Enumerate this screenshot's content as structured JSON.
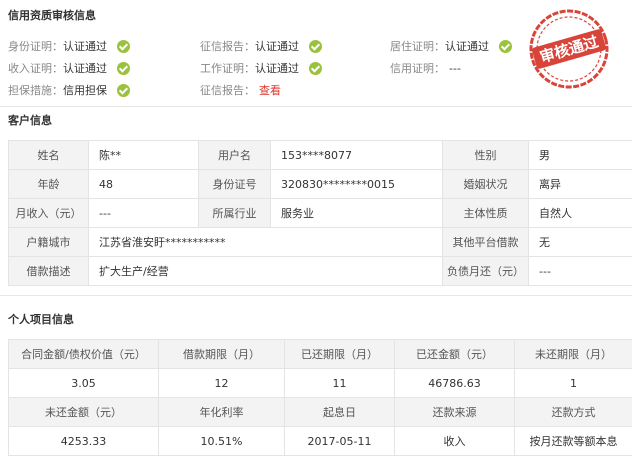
{
  "credit": {
    "title": "信用资质审核信息",
    "items": [
      {
        "label": "身份证明：",
        "value": "认证通过",
        "checked": true
      },
      {
        "label": "征信报告：",
        "value": "认证通过",
        "checked": true
      },
      {
        "label": "居住证明：",
        "value": "认证通过",
        "checked": true
      },
      {
        "label": "收入证明：",
        "value": "认证通过",
        "checked": true
      },
      {
        "label": "工作证明：",
        "value": "认证通过",
        "checked": true
      },
      {
        "label": "信用证明：",
        "value": "---",
        "checked": false
      },
      {
        "label": "担保措施：",
        "value": "信用担保",
        "checked": true
      },
      {
        "label": "征信报告：",
        "value": "查看",
        "checked": false,
        "link": true
      }
    ],
    "stamp_text": "审核通过",
    "stamp_color": "#d9443a"
  },
  "customer": {
    "title": "客户信息",
    "rows": [
      [
        "姓名",
        "陈**",
        "用户名",
        "153****8077",
        "性别",
        "男"
      ],
      [
        "年龄",
        "48",
        "身份证号",
        "320830********0015",
        "婚姻状况",
        "离异"
      ],
      [
        "月收入（元）",
        "---",
        "所属行业",
        "服务业",
        "主体性质",
        "自然人"
      ],
      [
        "户籍城市",
        "江苏省淮安盱***********",
        "其他平台借款",
        "无"
      ],
      [
        "借款描述",
        "扩大生产/经营",
        "负债月还（元）",
        "---"
      ]
    ]
  },
  "project": {
    "title": "个人项目信息",
    "rows": [
      [
        "合同金额/债权价值（元）",
        "借款期限（月）",
        "已还期限（月）",
        "已还金额（元）",
        "未还期限（月）"
      ],
      [
        "3.05",
        "12",
        "11",
        "46786.63",
        "1"
      ],
      [
        "未还金额（元）",
        "年化利率",
        "起息日",
        "还款来源",
        "还款方式"
      ],
      [
        "4253.33",
        "10.51%",
        "2017-05-11",
        "收入",
        "按月还款等额本息"
      ]
    ]
  },
  "colors": {
    "check": "#9bc23c",
    "link": "#e0352b",
    "label_bg": "#f3f3f3",
    "border": "#e4e4e4"
  }
}
